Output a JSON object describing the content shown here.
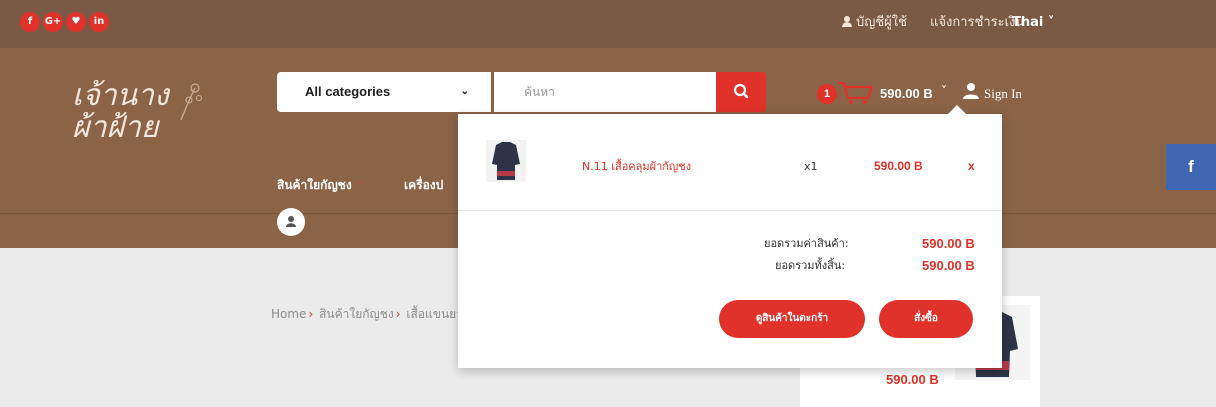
{
  "topbar": {
    "social": [
      {
        "name": "facebook",
        "glyph": "f"
      },
      {
        "name": "google-plus",
        "glyph": "G+"
      },
      {
        "name": "twitter",
        "glyph": "♥"
      },
      {
        "name": "linkedin",
        "glyph": "in"
      }
    ],
    "account_label": "บัญชีผู้ใช้",
    "payment_label": "แจ้งการชำระเงิน",
    "language": "Thai ˅"
  },
  "header": {
    "logo_line1": "เจ้านาง",
    "logo_line2": "ผ้าฝ้าย",
    "category_label": "All categories",
    "category_chevron": "⌄",
    "search_placeholder": "ค้นหา",
    "cart_count": "1",
    "cart_total": "590.00 B",
    "cart_chevron": "˅",
    "signin_label": "Sign In"
  },
  "nav": {
    "items": [
      {
        "label": "สินค้าใยกัญชง",
        "chevron": "˅"
      },
      {
        "label": "เครื่องป"
      }
    ]
  },
  "breadcrumb": {
    "home": "Home",
    "category": "สินค้าใยกัญชง",
    "current": "เสื้อแขนยา",
    "separator": "›"
  },
  "product_card": {
    "price": "590.00 B"
  },
  "social_side": {
    "label": "f"
  },
  "cart_dropdown": {
    "item": {
      "name": "N.11 เสื้อคลุมผ้ากัญชง",
      "quantity": "x1",
      "price": "590.00 B",
      "remove_label": "x"
    },
    "subtotal_label": "ยอดรวมค่าสินค้า:",
    "subtotal_value": "590.00 B",
    "total_label": "ยอดรวมทั้งสิ้น:",
    "total_value": "590.00 B",
    "view_cart_label": "ดูสินค้าในตะกร้า",
    "checkout_label": "สั่งซื้อ"
  },
  "colors": {
    "topbar_bg": "#7a5a44",
    "header_bg": "#8b6447",
    "accent_red": "#e0312a",
    "page_bg": "#ebebeb",
    "facebook_blue": "#4267b2"
  }
}
